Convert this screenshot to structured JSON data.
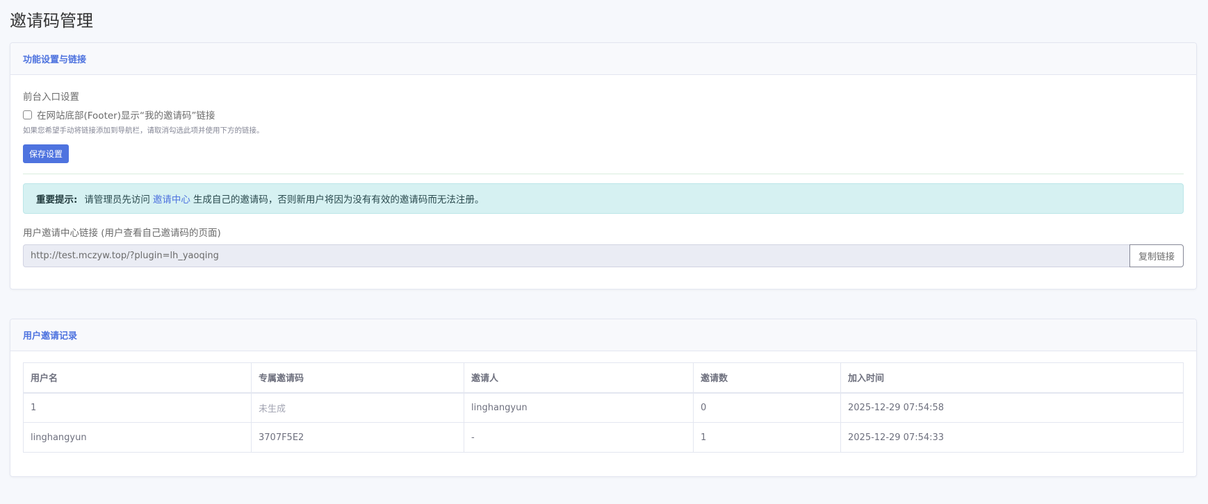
{
  "page": {
    "title": "邀请码管理"
  },
  "settings_card": {
    "header": "功能设置与链接",
    "section_label": "前台入口设置",
    "checkbox_label": "在网站底部(Footer)显示“我的邀请码”链接",
    "checkbox_checked": false,
    "hint": "如果您希望手动将链接添加到导航栏，请取消勾选此项并使用下方的链接。",
    "save_button": "保存设置",
    "alert": {
      "strong": "重要提示:",
      "before_link": "请管理员先访问",
      "link_text": "邀请中心",
      "after_link": "生成自己的邀请码，否则新用户将因为没有有效的邀请码而无法注册。"
    },
    "url_label": "用户邀请中心链接 (用户查看自己邀请码的页面)",
    "url_value": "http://test.mczyw.top/?plugin=lh_yaoqing",
    "copy_button": "复制链接"
  },
  "records_card": {
    "header": "用户邀请记录",
    "columns": [
      "用户名",
      "专属邀请码",
      "邀请人",
      "邀请数",
      "加入时间"
    ],
    "rows": [
      [
        "1",
        "未生成",
        "linghangyun",
        "0",
        "2025-12-29 07:54:58"
      ],
      [
        "linghangyun",
        "3707F5E2",
        "-",
        "1",
        "2025-12-29 07:54:33"
      ]
    ]
  },
  "colors": {
    "accent": "#4e73df",
    "alert_bg": "#d6f1f2",
    "page_bg": "#f6f8fc"
  }
}
